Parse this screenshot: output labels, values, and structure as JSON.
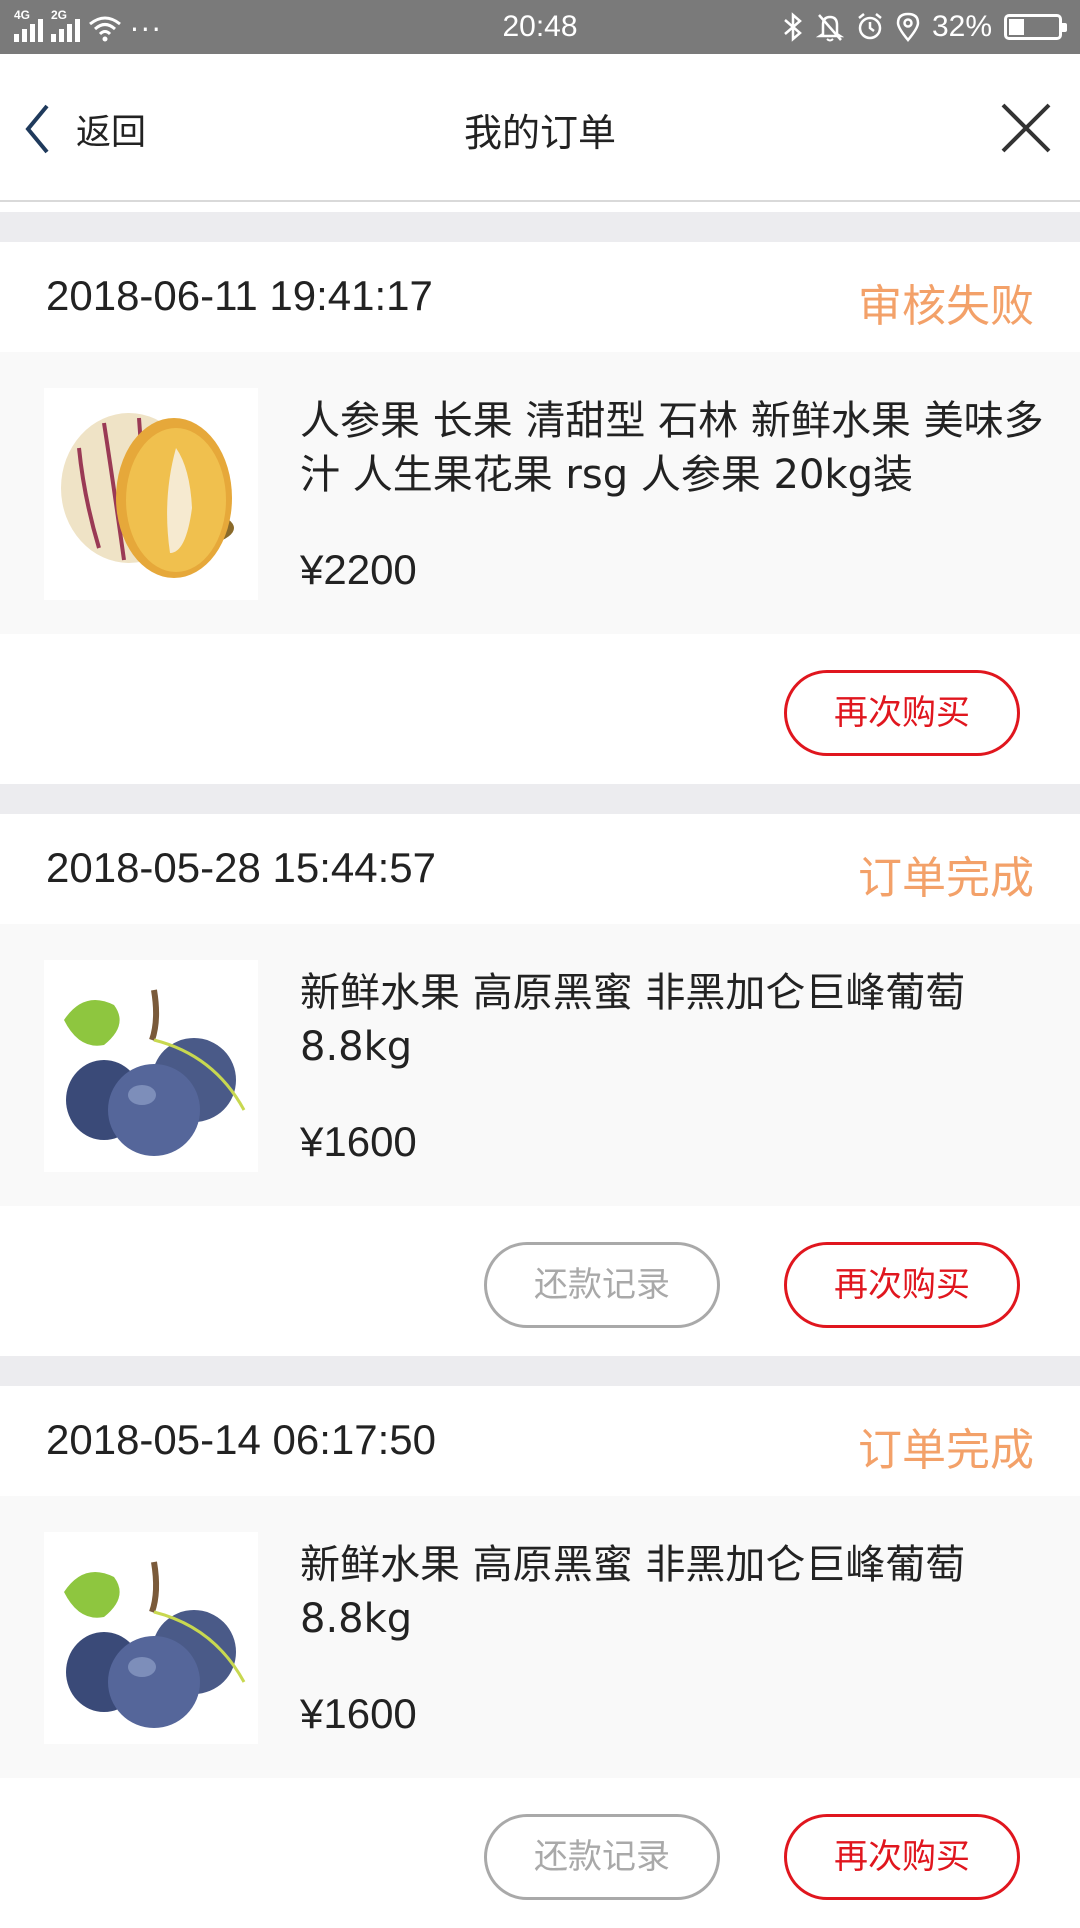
{
  "status_bar": {
    "network_1": "4G",
    "network_2": "2G",
    "more": "···",
    "time": "20:48",
    "battery_percent": "32%",
    "battery_level": 0.32,
    "icons": [
      "bluetooth-icon",
      "silent-bell-icon",
      "alarm-icon",
      "location-icon",
      "battery-icon"
    ]
  },
  "navbar": {
    "back_label": "返回",
    "title": "我的订单"
  },
  "orders": [
    {
      "date": "2018-06-11 19:41:17",
      "status": "审核失败",
      "item_name": "人参果 长果 清甜型 石林 新鲜水果 美味多汁 人生果花果 rsg 人参果 20kg装",
      "price": "¥2200",
      "buttons": [
        "再次购买"
      ]
    },
    {
      "date": "2018-05-28 15:44:57",
      "status": "订单完成",
      "item_name": "新鲜水果 高原黑蜜 非黑加仑巨峰葡萄 8.8kg",
      "price": "¥1600",
      "buttons": [
        "还款记录",
        "再次购买"
      ]
    },
    {
      "date": "2018-05-14 06:17:50",
      "status": "订单完成",
      "item_name": "新鲜水果 高原黑蜜 非黑加仑巨峰葡萄 8.8kg",
      "price": "¥1600",
      "buttons": [
        "还款记录",
        "再次购买"
      ]
    }
  ],
  "colors": {
    "status_text": "#f3a169",
    "primary_button": "#e0161e",
    "secondary_button": "#a9a9a9",
    "status_bar_bg": "#7a7a7a",
    "section_gap": "#ececef"
  }
}
